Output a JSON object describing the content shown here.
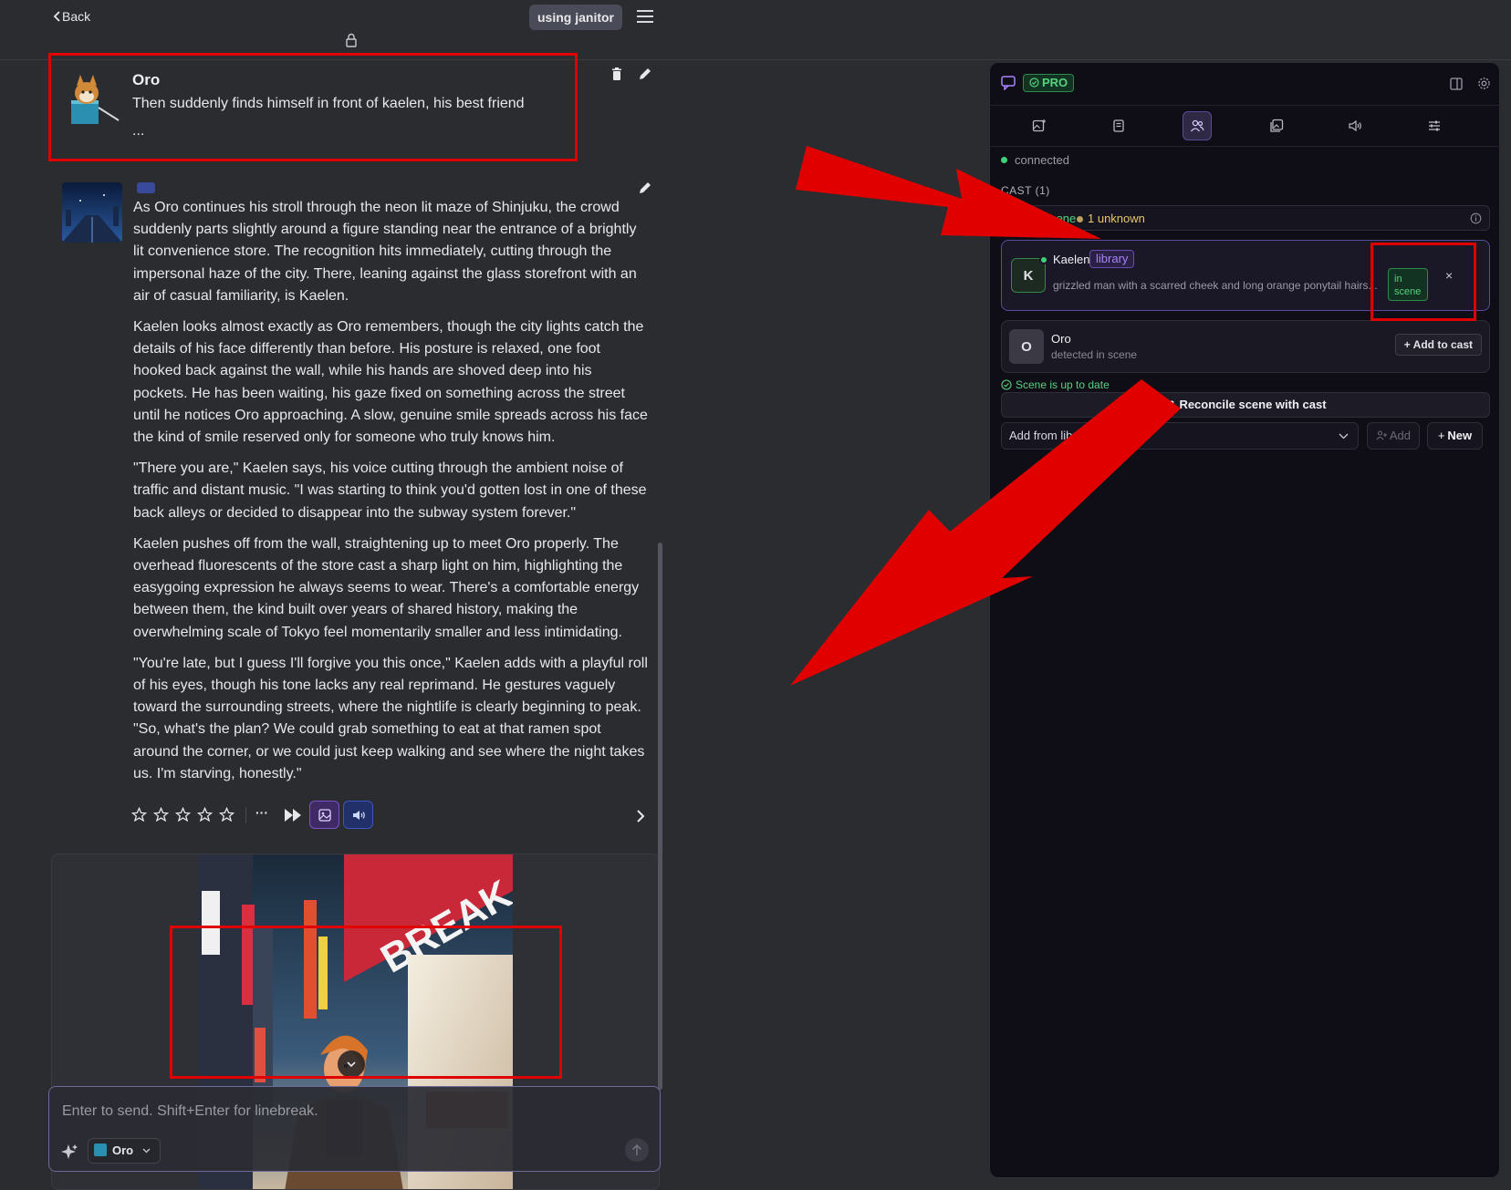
{
  "topbar": {
    "back_label": "Back",
    "using_label": "using janitor"
  },
  "message1": {
    "name": "Oro",
    "text": "Then suddenly finds himself in front of kaelen, his best friend",
    "more": "..."
  },
  "message2": {
    "paragraphs": [
      "As Oro continues his stroll through the neon lit maze of Shinjuku, the crowd suddenly parts slightly around a figure standing near the entrance of a brightly lit convenience store. The recognition hits immediately, cutting through the impersonal haze of the city. There, leaning against the glass storefront with an air of casual familiarity, is Kaelen.",
      "Kaelen looks almost exactly as Oro remembers, though the city lights catch the details of his face differently than before. His posture is relaxed, one foot hooked back against the wall, while his hands are shoved deep into his pockets. He has been waiting, his gaze fixed on something across the street until he notices Oro approaching. A slow, genuine smile spreads across his face the kind of smile reserved only for someone who truly knows him.",
      "\"There you are,\" Kaelen says, his voice cutting through the ambient noise of traffic and distant music. \"I was starting to think you'd gotten lost in one of these back alleys or decided to disappear into the subway system forever.\"",
      "Kaelen pushes off from the wall, straightening up to meet Oro properly. The overhead fluorescents of the store cast a sharp light on him, highlighting the easygoing expression he always seems to wear. There's a comfortable energy between them, the kind built over years of shared history, making the overwhelming scale of Tokyo feel momentarily smaller and less intimidating.",
      "\"You're late, but I guess I'll forgive you this once,\" Kaelen adds with a playful roll of his eyes, though his tone lacks any real reprimand. He gestures vaguely toward the surrounding streets, where the nightlife is clearly beginning to peak. \"So, what's the plan? We could grab something to eat at that ramen spot around the corner, or we could just keep walking and see where the night takes us. I'm starving, honestly.\""
    ],
    "more_label": "···"
  },
  "composer": {
    "placeholder": "Enter to send. Shift+Enter for linebreak.",
    "character": "Oro"
  },
  "panel": {
    "pro_label": "PRO",
    "connection": "connected",
    "cast_header": "CAST (1)",
    "summary_scene": "1 in scene",
    "summary_unknown": "1 unknown",
    "cast": [
      {
        "initial": "K",
        "name": "Kaelen",
        "tag": "library",
        "description": "grizzled man with a scarred cheek and long orange ponytail hairs...",
        "status_line1": "in",
        "status_line2": "scene",
        "remove": "×"
      },
      {
        "initial": "O",
        "name": "Oro",
        "subtitle": "detected in scene",
        "action": "+ Add to cast"
      }
    ],
    "scene_status": "Scene is up to date",
    "reconcile_label": "Reconcile scene with cast",
    "add_from_label": "Add from library...",
    "add_label": "Add",
    "new_label": "New"
  },
  "colors": {
    "annotation_red": "#e00000",
    "accent_purple": "#5b4a9a",
    "status_green": "#55d37e"
  }
}
